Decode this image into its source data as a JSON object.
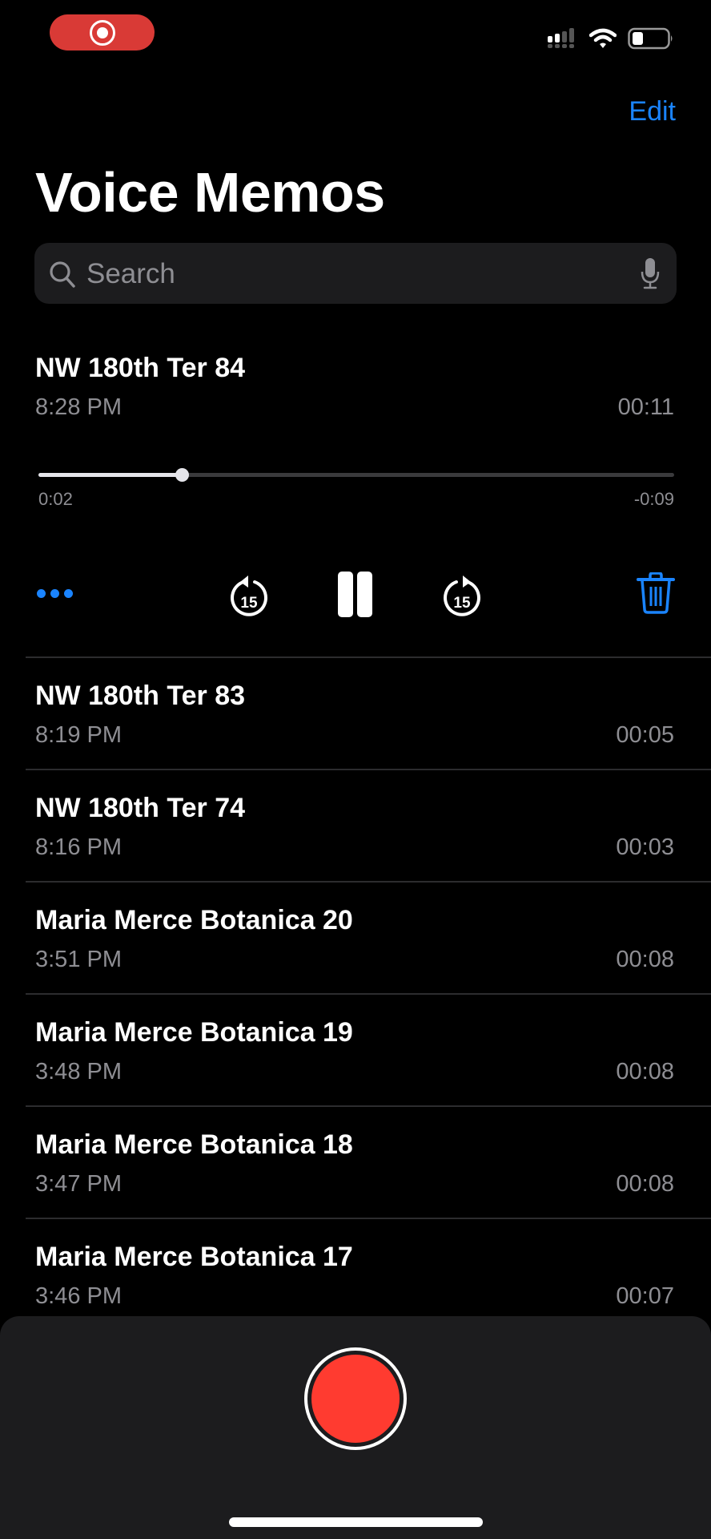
{
  "status_bar": {
    "recording_indicator": "screen-recording",
    "icons": [
      "cellular-signal-icon",
      "wifi-icon",
      "battery-icon"
    ],
    "battery_level": 0.25
  },
  "header": {
    "edit_label": "Edit",
    "title": "Voice Memos"
  },
  "search": {
    "placeholder": "Search"
  },
  "active_memo": {
    "title": "NW 180th Ter 84",
    "time": "8:28 PM",
    "duration": "00:11",
    "elapsed": "0:02",
    "remaining": "-0:09",
    "progress": 0.225
  },
  "controls": {
    "more": "more-options",
    "skip_back": "15",
    "play_state": "pause",
    "skip_forward": "15",
    "delete": "trash"
  },
  "memos": [
    {
      "title": "NW 180th Ter 83",
      "time": "8:19 PM",
      "duration": "00:05"
    },
    {
      "title": "NW 180th Ter 74",
      "time": "8:16 PM",
      "duration": "00:03"
    },
    {
      "title": "Maria Merce Botanica 20",
      "time": "3:51 PM",
      "duration": "00:08"
    },
    {
      "title": "Maria Merce Botanica 19",
      "time": "3:48 PM",
      "duration": "00:08"
    },
    {
      "title": "Maria Merce Botanica 18",
      "time": "3:47 PM",
      "duration": "00:08"
    },
    {
      "title": "Maria Merce Botanica 17",
      "time": "3:46 PM",
      "duration": "00:07"
    }
  ],
  "colors": {
    "accent": "#1a84ff",
    "record": "#ff3b30",
    "recording_pill": "#d93a36"
  }
}
